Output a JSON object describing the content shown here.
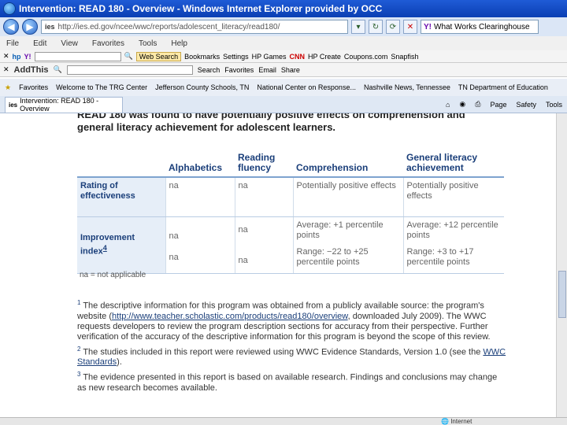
{
  "window": {
    "title": "Intervention: READ 180 - Overview - Windows Internet Explorer provided by OCC"
  },
  "address_bar": {
    "url": "http://ies.ed.gov/ncee/wwc/reports/adolescent_literacy/read180/",
    "search_value": "What Works Clearinghouse"
  },
  "menu": [
    "File",
    "Edit",
    "View",
    "Favorites",
    "Tools",
    "Help"
  ],
  "toolbar1": {
    "search_label": "Web Search",
    "items": [
      "Bookmarks",
      "Settings",
      "HP Games",
      "CNN",
      "HP Create",
      "Coupons.com",
      "Snapfish"
    ]
  },
  "toolbar2": {
    "add_this": "AddThis",
    "search_label": "Search",
    "items": [
      "Favorites",
      "Email",
      "Share"
    ]
  },
  "favorites_bar": {
    "label": "Favorites",
    "items": [
      "Welcome to The TRG Center",
      "Jefferson County Schools, TN",
      "National Center on Response...",
      "Nashville News, Tennessee",
      "TN Department of Education"
    ]
  },
  "tab": {
    "title": "Intervention: READ 180 - Overview"
  },
  "tab_tools": [
    "Page",
    "Safety",
    "Tools"
  ],
  "content": {
    "intro": "READ 180 was found to have potentially positive effects on comprehension and general literacy achievement for adolescent learners.",
    "table": {
      "headers": [
        "",
        "Alphabetics",
        "Reading fluency",
        "Comprehension",
        "General literacy achievement"
      ],
      "row1": {
        "label": "Rating of effectiveness",
        "cells": [
          "na",
          "na",
          "Potentially positive effects",
          "Potentially positive effects"
        ]
      },
      "row2": {
        "label": "Improvement index",
        "label_sup": "4",
        "alphabetics": [
          "na",
          "na"
        ],
        "fluency": [
          "na",
          "na"
        ],
        "comprehension": [
          "Average: +1 percentile points",
          "Range: −22 to +25 percentile points"
        ],
        "general": [
          "Average: +12 percentile points",
          "Range: +3 to +17 percentile points"
        ]
      }
    },
    "na_note": "na = not applicable",
    "footnotes": [
      {
        "num": "1",
        "text_a": "The descriptive information for this program was obtained from a publicly available source: the program's website (",
        "link": "http://www.teacher.scholastic.com/products/read180/overview",
        "text_b": ", downloaded July 2009). The WWC requests developers to review the program description sections for accuracy from their perspective. Further verification of the accuracy of the descriptive information for this program is beyond the scope of this review."
      },
      {
        "num": "2",
        "text_a": "The studies included in this report were reviewed using WWC Evidence Standards, Version 1.0 (see the ",
        "link": "WWC Standards",
        "text_b": ")."
      },
      {
        "num": "3",
        "text_a": "The evidence presented in this report is based on available research. Findings and conclusions may change as new research becomes available.",
        "link": "",
        "text_b": ""
      }
    ]
  },
  "status": {
    "zone": "Internet"
  }
}
